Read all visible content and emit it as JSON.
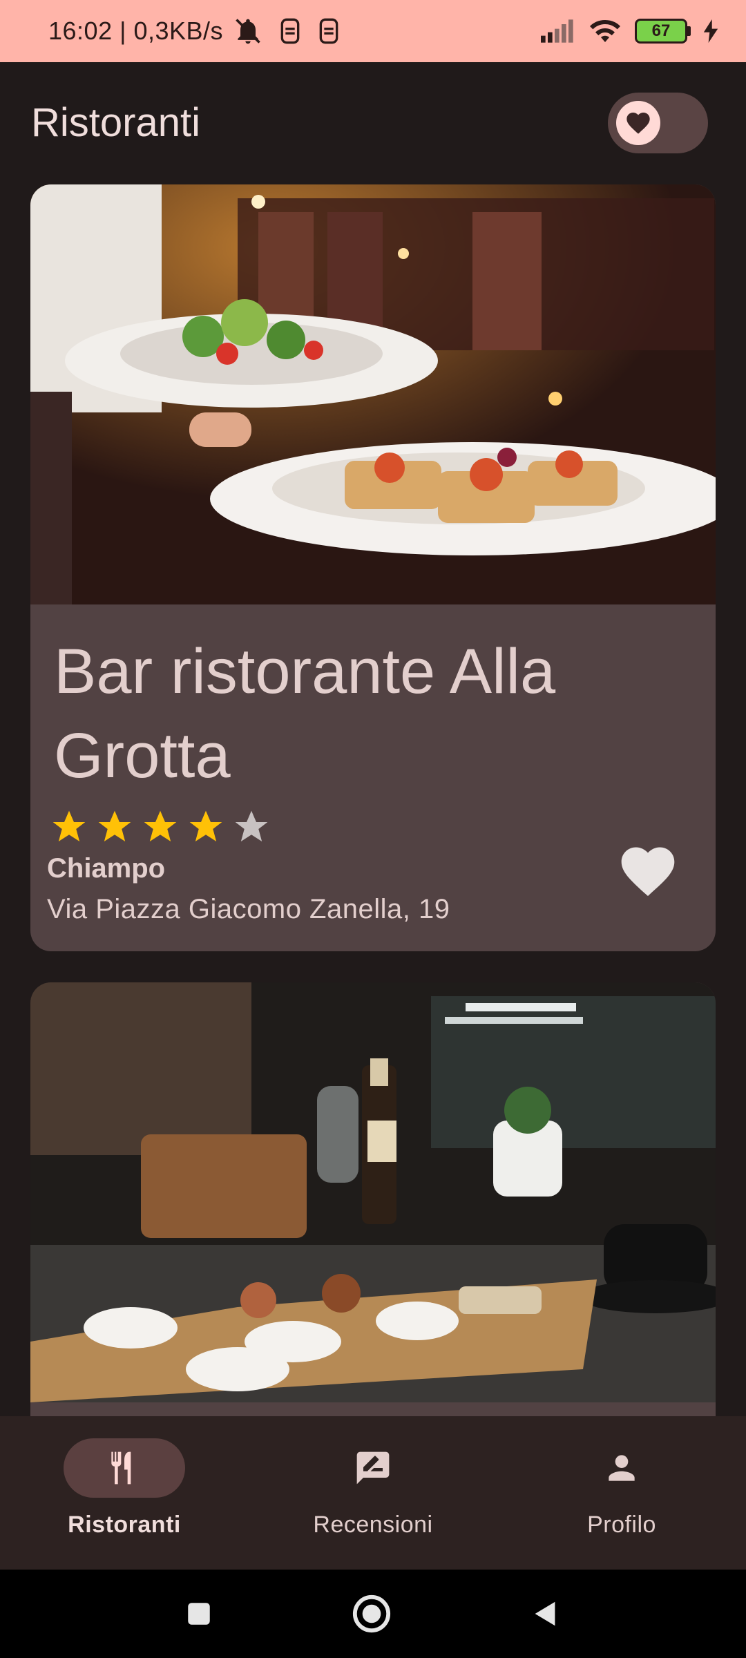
{
  "status_bar": {
    "time_speed": "16:02 | 0,3KB/s",
    "battery": "67"
  },
  "app_bar": {
    "title": "Ristoranti",
    "favorites_toggle": "off"
  },
  "restaurants": [
    {
      "name": "Bar ristorante Alla Grotta",
      "rating": 4,
      "max_rating": 5,
      "city": "Chiampo",
      "address": "Via Piazza Giacomo Zanella, 19"
    }
  ],
  "bottom_nav": {
    "items": [
      {
        "label": "Ristoranti",
        "icon": "fork-knife-icon",
        "active": true
      },
      {
        "label": "Recensioni",
        "icon": "rate-review-icon",
        "active": false
      },
      {
        "label": "Profilo",
        "icon": "person-icon",
        "active": false
      }
    ]
  },
  "colors": {
    "status_bar": "#ffb4a9",
    "background": "#201a1a",
    "card": "#524243",
    "star_filled": "#ffc107",
    "star_empty": "#c8c2c2"
  }
}
